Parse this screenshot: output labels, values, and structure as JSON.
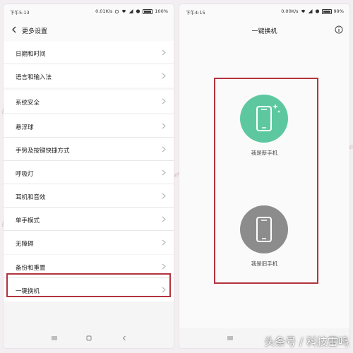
{
  "left_screen": {
    "status": {
      "time": "下午5:13",
      "speed": "0.01K/s",
      "battery": "100%"
    },
    "title": "更多设置",
    "groups": [
      [
        "日期和时间",
        "语言和输入法"
      ],
      [
        "系统安全"
      ],
      [
        "悬浮球",
        "手势及按键快捷方式",
        "呼吸灯",
        "耳机和音效",
        "单手模式",
        "无障碍"
      ],
      [
        "备份和重置",
        "一键换机"
      ]
    ]
  },
  "right_screen": {
    "status": {
      "time": "下午4:15",
      "speed": "0.00K/s",
      "battery": "99%"
    },
    "title": "一键换机",
    "new_phone_label": "我是新手机",
    "old_phone_label": "我是旧手机"
  },
  "colors": {
    "new_phone": "#5dc8a0",
    "old_phone": "#8c8c8c",
    "highlight": "#b3333e"
  },
  "watermark": "头条号 / 科技雷鸣"
}
